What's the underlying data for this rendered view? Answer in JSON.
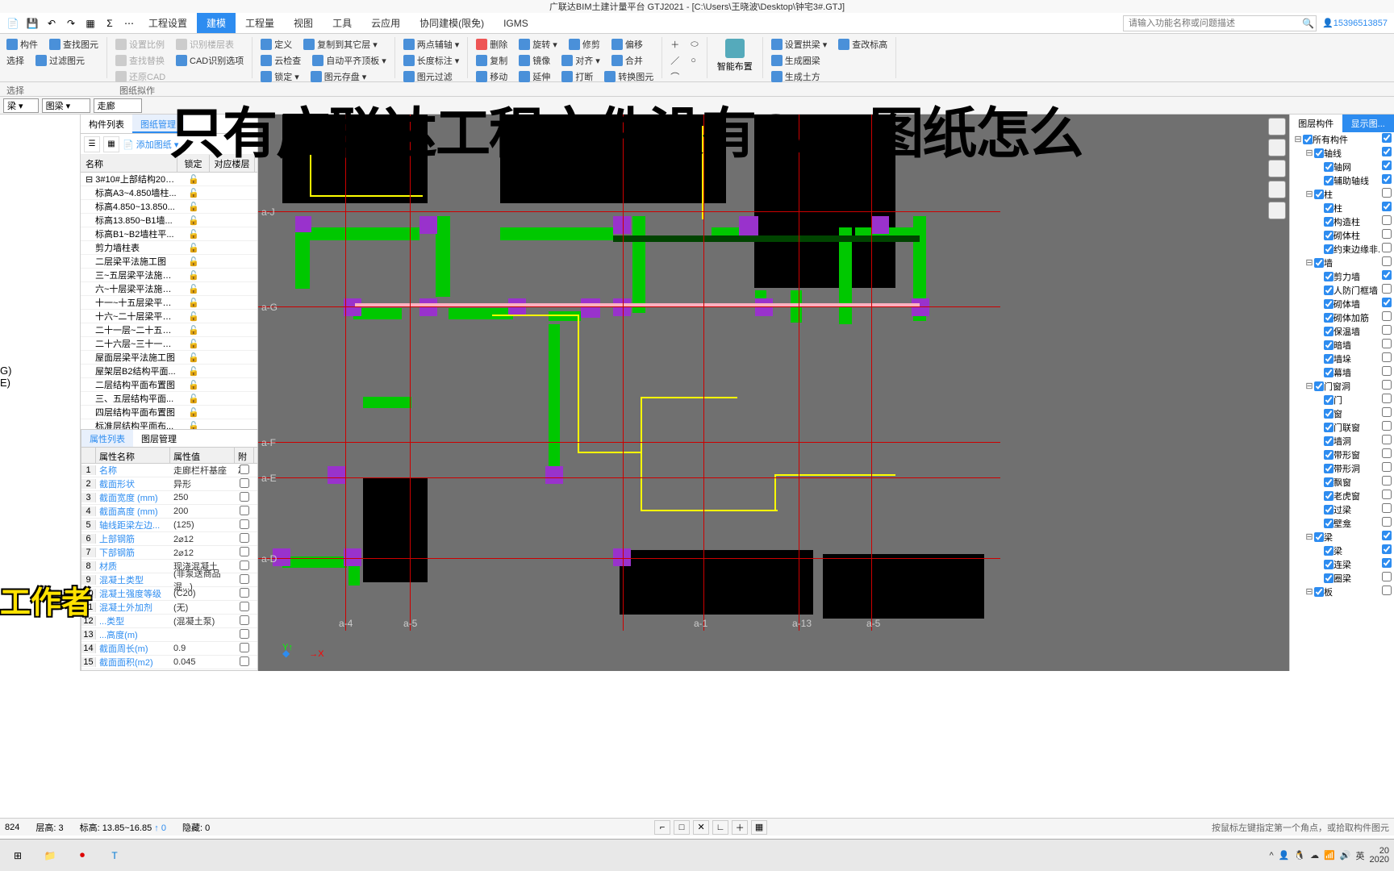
{
  "title": "广联达BIM土建计量平台 GTJ2021 - [C:\\Users\\王晓波\\Desktop\\钟宅3#.GTJ]",
  "menus": {
    "setup": "工程设置",
    "build": "建模",
    "qty": "工程量",
    "view": "视图",
    "tool": "工具",
    "cloud": "云应用",
    "collab": "协同建模(限免)",
    "igms": "IGMS"
  },
  "search_placeholder": "请输入功能名称或问题描述",
  "user": "15396513857",
  "ribbon": {
    "g1": {
      "component": "构件",
      "find": "查找图元",
      "select": "选择",
      "filter": "过滤图元"
    },
    "g2": {
      "scale": "设置比例",
      "layer": "识别楼层表",
      "findrep": "查找替换",
      "cadopt": "CAD识别选项",
      "restore": "还原CAD"
    },
    "g3": {
      "define": "定义",
      "cloudcheck": "云检查",
      "auto": "自动平齐顶板",
      "lock": "锁定",
      "copyto": "复制到其它层",
      "save": "图元存盘"
    },
    "g4": {
      "twopt": "两点辅轴",
      "lendim": "长度标注",
      "extend": "图元过滤"
    },
    "g5": {
      "del": "删除",
      "copy": "复制",
      "move": "移动",
      "rotate": "旋转",
      "mirror": "镜像",
      "stretch": "延伸",
      "trim": "修剪",
      "align": "对齐",
      "break": "打断",
      "offset": "偏移",
      "merge": "合并",
      "splitconv": "转换图元"
    },
    "g6": {
      "smart": "智能布置"
    },
    "g7": {
      "arch": "设置拱梁",
      "gen": "生成圈梁",
      "gen2": "生成土方",
      "changehdr": "查改标高"
    }
  },
  "sections": {
    "select": "选择",
    "paper": "图纸拟作"
  },
  "dd": {
    "floor": "梁",
    "cat": "图梁",
    "sub": "走廊"
  },
  "dwtabs": {
    "list": "构件列表",
    "mgr": "图纸管理"
  },
  "dwtool": {
    "add": "添加图纸"
  },
  "dwhdr": {
    "name": "名称",
    "lock": "锁定",
    "floor": "对应楼层"
  },
  "drawings": [
    "3#10#上部结构2020...",
    "标高A3~4.850墙柱...",
    "标高4.850~13.850...",
    "标高13.850~B1墙...",
    "标高B1~B2墙柱平...",
    "剪力墙柱表",
    "二层梁平法施工图",
    "三~五层梁平法施工图",
    "六~十层梁平法施工图",
    "十一~十五层梁平法...",
    "十六~二十层梁平法...",
    "二十一层~二十五层...",
    "二十六层~三十一层...",
    "屋面层梁平法施工图",
    "屋架层B2结构平面...",
    "二层结构平面布置图",
    "三、五层结构平面...",
    "四层结构平面布置图",
    "标准层结构平面布..."
  ],
  "proptabs": {
    "list": "属性列表",
    "layer": "图层管理"
  },
  "prophdr": {
    "name": "属性名称",
    "value": "属性值",
    "extra": "附加"
  },
  "props": [
    {
      "n": "1",
      "k": "名称",
      "v": "走廊栏杆基座"
    },
    {
      "n": "2",
      "k": "截面形状",
      "v": "异形"
    },
    {
      "n": "3",
      "k": "截面宽度 (mm)",
      "v": "250"
    },
    {
      "n": "4",
      "k": "截面高度 (mm)",
      "v": "200"
    },
    {
      "n": "5",
      "k": "轴线距梁左边...",
      "v": "(125)"
    },
    {
      "n": "6",
      "k": "上部钢筋",
      "v": "2⌀12"
    },
    {
      "n": "7",
      "k": "下部钢筋",
      "v": "2⌀12"
    },
    {
      "n": "8",
      "k": "材质",
      "v": "现浇混凝土"
    },
    {
      "n": "9",
      "k": "混凝土类型",
      "v": "(非泵送商品混...)"
    },
    {
      "n": "10",
      "k": "混凝土强度等级",
      "v": "(C20)"
    },
    {
      "n": "11",
      "k": "混凝土外加剂",
      "v": "(无)"
    },
    {
      "n": "12",
      "k": "...类型",
      "v": "(混凝土泵)"
    },
    {
      "n": "13",
      "k": "...高度(m)",
      "v": ""
    },
    {
      "n": "14",
      "k": "截面周长(m)",
      "v": "0.9"
    },
    {
      "n": "15",
      "k": "截面面积(m2)",
      "v": "0.045"
    }
  ],
  "layertabs": {
    "comp": "图层构件",
    "show": "显示图..."
  },
  "layers": [
    {
      "nm": "所有构件",
      "lvl": 0,
      "c1": true,
      "c2": true
    },
    {
      "nm": "轴线",
      "lvl": 1,
      "c1": true,
      "c2": true
    },
    {
      "nm": "轴网",
      "lvl": 2,
      "c1": true,
      "c2": true
    },
    {
      "nm": "辅助轴线",
      "lvl": 2,
      "c1": true,
      "c2": true
    },
    {
      "nm": "柱",
      "lvl": 1,
      "c1": true,
      "c2": false
    },
    {
      "nm": "柱",
      "lvl": 2,
      "c1": true,
      "c2": true
    },
    {
      "nm": "构造柱",
      "lvl": 2,
      "c1": true,
      "c2": false
    },
    {
      "nm": "砌体柱",
      "lvl": 2,
      "c1": true,
      "c2": false
    },
    {
      "nm": "约束边缘非...",
      "lvl": 2,
      "c1": true,
      "c2": false
    },
    {
      "nm": "墙",
      "lvl": 1,
      "c1": true,
      "c2": false
    },
    {
      "nm": "剪力墙",
      "lvl": 2,
      "c1": true,
      "c2": true
    },
    {
      "nm": "人防门框墙",
      "lvl": 2,
      "c1": true,
      "c2": false
    },
    {
      "nm": "砌体墙",
      "lvl": 2,
      "c1": true,
      "c2": true
    },
    {
      "nm": "砌体加筋",
      "lvl": 2,
      "c1": true,
      "c2": false
    },
    {
      "nm": "保温墙",
      "lvl": 2,
      "c1": true,
      "c2": false
    },
    {
      "nm": "暗墙",
      "lvl": 2,
      "c1": true,
      "c2": false
    },
    {
      "nm": "墙垛",
      "lvl": 2,
      "c1": true,
      "c2": false
    },
    {
      "nm": "幕墙",
      "lvl": 2,
      "c1": true,
      "c2": false
    },
    {
      "nm": "门窗洞",
      "lvl": 1,
      "c1": true,
      "c2": false
    },
    {
      "nm": "门",
      "lvl": 2,
      "c1": true,
      "c2": false
    },
    {
      "nm": "窗",
      "lvl": 2,
      "c1": true,
      "c2": false
    },
    {
      "nm": "门联窗",
      "lvl": 2,
      "c1": true,
      "c2": false
    },
    {
      "nm": "墙洞",
      "lvl": 2,
      "c1": true,
      "c2": false
    },
    {
      "nm": "带形窗",
      "lvl": 2,
      "c1": true,
      "c2": false
    },
    {
      "nm": "带形洞",
      "lvl": 2,
      "c1": true,
      "c2": false
    },
    {
      "nm": "飘窗",
      "lvl": 2,
      "c1": true,
      "c2": false
    },
    {
      "nm": "老虎窗",
      "lvl": 2,
      "c1": true,
      "c2": false
    },
    {
      "nm": "过梁",
      "lvl": 2,
      "c1": true,
      "c2": false
    },
    {
      "nm": "壁龛",
      "lvl": 2,
      "c1": true,
      "c2": false
    },
    {
      "nm": "梁",
      "lvl": 1,
      "c1": true,
      "c2": true
    },
    {
      "nm": "梁",
      "lvl": 2,
      "c1": true,
      "c2": true
    },
    {
      "nm": "连梁",
      "lvl": 2,
      "c1": true,
      "c2": true
    },
    {
      "nm": "圈梁",
      "lvl": 2,
      "c1": true,
      "c2": false
    },
    {
      "nm": "板",
      "lvl": 1,
      "c1": true,
      "c2": false
    }
  ],
  "axes": {
    "j": "a-J",
    "g": "a-G",
    "f": "a-F",
    "e": "a-E",
    "d": "a-D",
    "4": "a-4",
    "5": "a-5",
    "1": "a-1",
    "13": "a-13",
    "5b": "a-5"
  },
  "status": {
    "coord": "824",
    "floor": "层高:",
    "floor_v": "3",
    "elev": "标高:",
    "elev_v": "13.85~16.85",
    "hide": "隐藏:",
    "hide_v": "0",
    "hint": "按鼠标左键指定第一个角点，或拾取构件图元"
  },
  "overlay": {
    "title": "只有广联达工程文件没有CAD图纸怎么",
    "sub": "工作者"
  },
  "left_edges": {
    "g": "G)",
    "e": "E)"
  },
  "tray": {
    "ime": "英",
    "time": "20",
    "date": "2020"
  }
}
